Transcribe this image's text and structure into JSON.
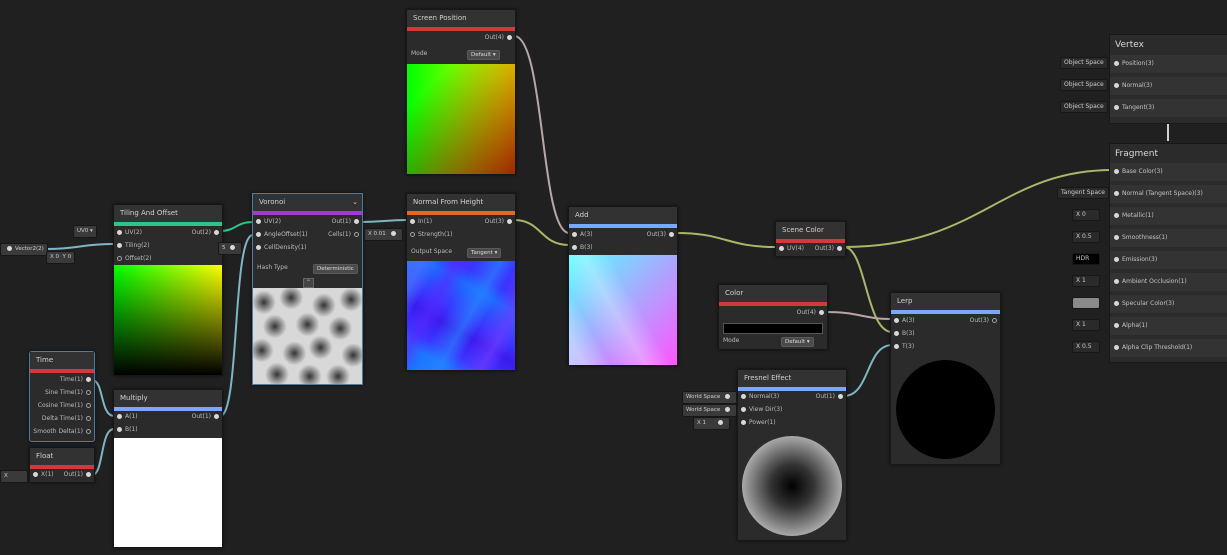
{
  "colors": {
    "background": "#202020",
    "uv_header": "#2bc58a",
    "vector_header": "#7aa8ff",
    "float_header": "#d23a3a",
    "voronoi_header": "#9b3dd6",
    "normal_header": "#e0682e",
    "wire_vector": "#a9b76a",
    "wire_float": "#7fb5c4",
    "wire_color": "#b9a6a6"
  },
  "vector2_input": {
    "label": "Vector2(2)",
    "x_label": "X",
    "x_value": "0",
    "y_label": "Y",
    "y_value": "0"
  },
  "tiling": {
    "title": "Tiling And Offset",
    "uv_dropdown": "UV0",
    "ports_in": [
      "UV(2)",
      "Tiling(2)",
      "Offset(2)"
    ],
    "out": "Out(2)"
  },
  "voronoi": {
    "title": "Voronoi",
    "ports_in": [
      "UV(2)",
      "AngleOffset(1)",
      "CellDensity(1)"
    ],
    "ports_out": [
      "Out(1)",
      "Cells(1)"
    ],
    "cell_density_value": "5",
    "hash_label": "Hash Type",
    "hash_value": "Deterministic"
  },
  "screen_position": {
    "title": "Screen Position",
    "out": "Out(4)",
    "mode_label": "Mode",
    "mode_value": "Default"
  },
  "normal_from_height": {
    "title": "Normal From Height",
    "ports_in": [
      "In(1)",
      "Strength(1)"
    ],
    "out": "Out(3)",
    "strength_x": "X",
    "strength_value": "0.01",
    "output_space_label": "Output Space",
    "output_space_value": "Tangent"
  },
  "add": {
    "title": "Add",
    "ports_in": [
      "A(3)",
      "B(3)"
    ],
    "out": "Out(3)"
  },
  "scene_color": {
    "title": "Scene Color",
    "in": "UV(4)",
    "out": "Out(3)"
  },
  "color": {
    "title": "Color",
    "out": "Out(4)",
    "mode_label": "Mode",
    "mode_value": "Default"
  },
  "lerp": {
    "title": "Lerp",
    "ports_in": [
      "A(3)",
      "B(3)",
      "T(3)"
    ],
    "out": "Out(3)"
  },
  "fresnel": {
    "title": "Fresnel Effect",
    "ports_in": [
      "Normal(3)",
      "View Dir(3)",
      "Power(1)"
    ],
    "out": "Out(1)",
    "normal_space": "World Space",
    "view_space": "World Space",
    "power_x": "X",
    "power_value": "1"
  },
  "time": {
    "title": "Time",
    "outputs": [
      "Time(1)",
      "Sine Time(1)",
      "Cosine Time(1)",
      "Delta Time(1)",
      "Smooth Delta(1)"
    ]
  },
  "multiply": {
    "title": "Multiply",
    "ports_in": [
      "A(1)",
      "B(1)"
    ],
    "out": "Out(1)"
  },
  "float_node": {
    "title": "Float",
    "in": "X(1)",
    "out": "Out(1)",
    "input_x": "X"
  },
  "vertex": {
    "title": "Vertex",
    "rows": [
      {
        "field": "Object Space",
        "label": "Position(3)"
      },
      {
        "field": "Object Space",
        "label": "Normal(3)"
      },
      {
        "field": "Object Space",
        "label": "Tangent(3)"
      }
    ]
  },
  "fragment": {
    "title": "Fragment",
    "rows": [
      {
        "field": "",
        "label": "Base Color(3)"
      },
      {
        "field": "Tangent Space",
        "label": "Normal (Tangent Space)(3)"
      },
      {
        "field": "X  0",
        "label": "Metallic(1)"
      },
      {
        "field": "X  0.5",
        "label": "Smoothness(1)"
      },
      {
        "field": "HDR",
        "label": "Emission(3)"
      },
      {
        "field": "X  1",
        "label": "Ambient Occlusion(1)"
      },
      {
        "field": "",
        "label": "Specular Color(3)"
      },
      {
        "field": "X  1",
        "label": "Alpha(1)"
      },
      {
        "field": "X  0.5",
        "label": "Alpha Clip Threshold(1)"
      }
    ]
  }
}
